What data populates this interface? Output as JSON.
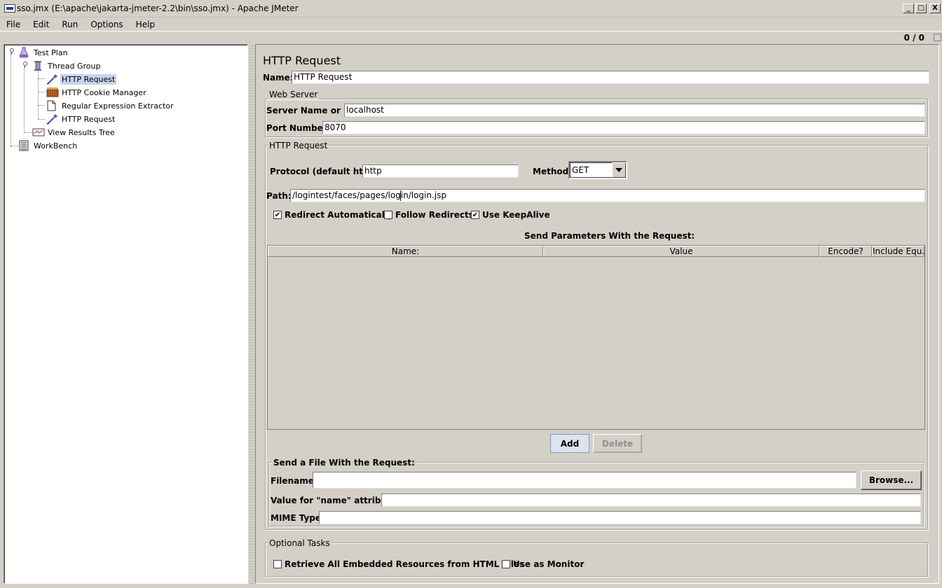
{
  "window": {
    "title": "sso.jmx (E:\\apache\\jakarta-jmeter-2.2\\bin\\sso.jmx) - Apache JMeter",
    "minimize_glyph": "_",
    "maximize_glyph": "□",
    "close_glyph": "X"
  },
  "menu": [
    "File",
    "Edit",
    "Run",
    "Options",
    "Help"
  ],
  "status": {
    "counter": "0 / 0"
  },
  "tree": [
    {
      "label": "Test Plan",
      "icon": "flask-icon",
      "level": 0
    },
    {
      "label": "Thread Group",
      "icon": "spool-icon",
      "level": 1
    },
    {
      "label": "HTTP Request",
      "icon": "pipette-icon",
      "level": 2,
      "selected": true
    },
    {
      "label": "HTTP Cookie Manager",
      "icon": "cookie-manager-icon",
      "level": 2
    },
    {
      "label": "Regular Expression Extractor",
      "icon": "page-icon",
      "level": 2
    },
    {
      "label": "HTTP Request",
      "icon": "pipette-icon",
      "level": 2
    },
    {
      "label": "View Results Tree",
      "icon": "results-tree-icon",
      "level": 1
    },
    {
      "label": "WorkBench",
      "icon": "workbench-icon",
      "level": 0
    }
  ],
  "form": {
    "title": "HTTP Request",
    "name_label": "Name:",
    "name_value": "HTTP Request",
    "web_server": {
      "title": "Web Server",
      "server_label": "Server Name or IP:",
      "server_value": "localhost",
      "port_label": "Port Number:",
      "port_value": "8070"
    },
    "http_request": {
      "title": "HTTP Request",
      "protocol_label": "Protocol (default http):",
      "protocol_value": "http",
      "method_label": "Method:",
      "method_value": "GET",
      "path_label": "Path:",
      "path_value": "/logintest/faces/pages/login/login.jsp",
      "redirect_auto": {
        "label": "Redirect Automatically",
        "checked": true
      },
      "follow_redirects": {
        "label": "Follow Redirects",
        "checked": false
      },
      "keepalive": {
        "label": "Use KeepAlive",
        "checked": true
      }
    },
    "params": {
      "title": "Send Parameters With the Request:",
      "columns": [
        "Name:",
        "Value",
        "Encode?",
        "Include Equ..."
      ],
      "add_label": "Add",
      "delete_label": "Delete"
    },
    "file": {
      "title": "Send a File With the Request:",
      "filename_label": "Filename:",
      "filename_value": "",
      "browse_label": "Browse...",
      "name_attr_label": "Value for \"name\" attribute:",
      "name_attr_value": "",
      "mime_label": "MIME Type:",
      "mime_value": ""
    },
    "optional": {
      "title": "Optional Tasks",
      "retrieve": {
        "label": "Retrieve All Embedded Resources from HTML Files",
        "checked": false
      },
      "monitor": {
        "label": "Use as Monitor",
        "checked": false
      }
    }
  }
}
